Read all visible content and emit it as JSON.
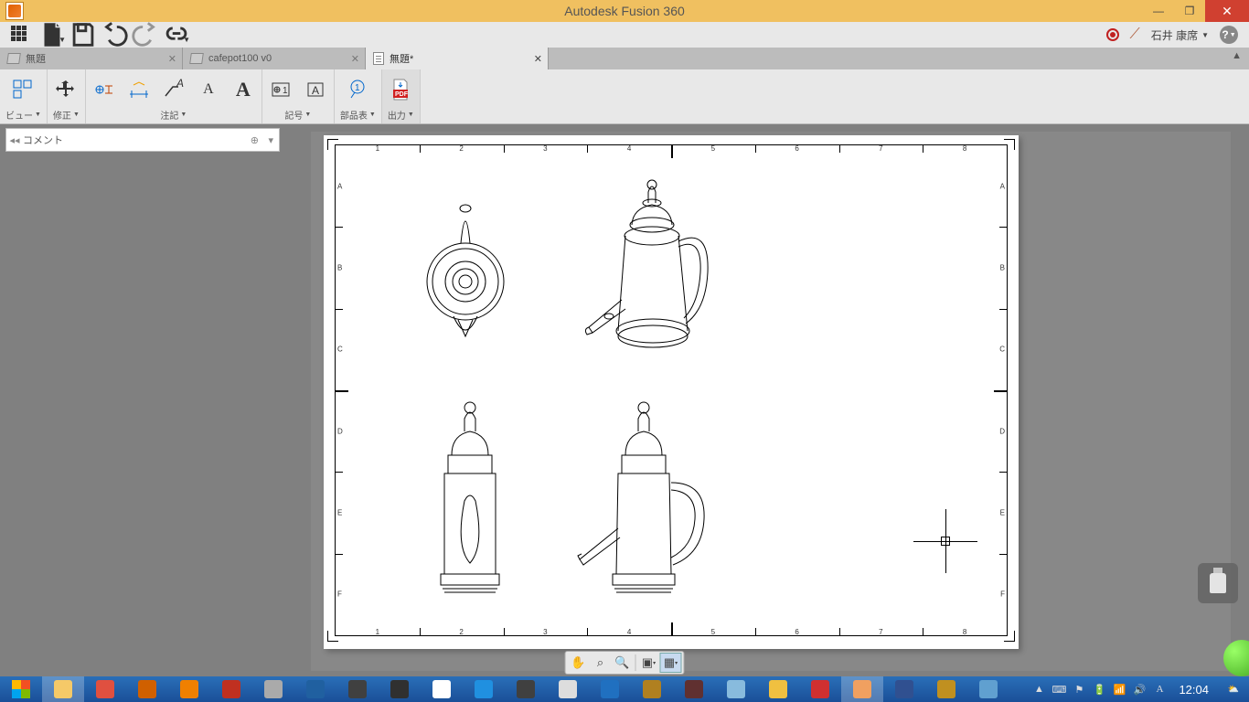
{
  "app": {
    "title": "Autodesk Fusion 360"
  },
  "user": {
    "name": "石井 康席"
  },
  "quick": {
    "icons": [
      "apps",
      "file",
      "save",
      "undo",
      "redo",
      "link"
    ]
  },
  "tabs": [
    {
      "label": "無題",
      "kind": "model",
      "active": false
    },
    {
      "label": "cafepot100 v0",
      "kind": "model",
      "active": false
    },
    {
      "label": "無題*",
      "kind": "sheet",
      "active": true
    }
  ],
  "ribbon": {
    "groups": [
      {
        "name": "view",
        "label": "ビュー",
        "icons": [
          "projview"
        ]
      },
      {
        "name": "modify",
        "label": "修正",
        "icons": [
          "move"
        ]
      },
      {
        "name": "annotate",
        "label": "注記",
        "icons": [
          "dim-target",
          "dim-line",
          "leader",
          "text-a",
          "text-A"
        ]
      },
      {
        "name": "symbol",
        "label": "記号",
        "icons": [
          "datum",
          "gdnt"
        ]
      },
      {
        "name": "parts",
        "label": "部品表",
        "icons": [
          "balloon"
        ]
      },
      {
        "name": "output",
        "label": "出力",
        "icons": [
          "pdf"
        ]
      }
    ]
  },
  "comments": {
    "label": "コメント"
  },
  "sheet": {
    "col_ticks": [
      "1",
      "2",
      "3",
      "4",
      "5",
      "6",
      "7",
      "8"
    ],
    "row_ticks": [
      "A",
      "B",
      "C",
      "D",
      "E",
      "F"
    ]
  },
  "viewbar": {
    "tools": [
      "pan",
      "zoom-window",
      "zoom",
      "fit",
      "display"
    ]
  },
  "taskbar": {
    "items": [
      {
        "name": "start",
        "bg": "#ffffff"
      },
      {
        "name": "explorer",
        "bg": "#f5c968",
        "active": true
      },
      {
        "name": "camera",
        "bg": "#e05040"
      },
      {
        "name": "office",
        "bg": "#d06000"
      },
      {
        "name": "media",
        "bg": "#f08000"
      },
      {
        "name": "sketchup",
        "bg": "#c03020"
      },
      {
        "name": "generic1",
        "bg": "#aaaaaa"
      },
      {
        "name": "earth",
        "bg": "#2060a0"
      },
      {
        "name": "app1",
        "bg": "#404040"
      },
      {
        "name": "eye",
        "bg": "#303030"
      },
      {
        "name": "chrome",
        "bg": "#ffffff"
      },
      {
        "name": "bluearrow",
        "bg": "#2090e0"
      },
      {
        "name": "swirl",
        "bg": "#404040"
      },
      {
        "name": "grid",
        "bg": "#dddddd"
      },
      {
        "name": "checkbox",
        "bg": "#2070c0"
      },
      {
        "name": "folder2",
        "bg": "#b08020"
      },
      {
        "name": "sphere",
        "bg": "#603030"
      },
      {
        "name": "app2",
        "bg": "#88bbdd"
      },
      {
        "name": "yellow",
        "bg": "#f0c040"
      },
      {
        "name": "opera",
        "bg": "#d03030"
      },
      {
        "name": "fusion",
        "bg": "#f0a060",
        "active": true
      },
      {
        "name": "word",
        "bg": "#305090"
      },
      {
        "name": "app3",
        "bg": "#c09020"
      },
      {
        "name": "photos",
        "bg": "#60a0d0"
      }
    ],
    "clock": "12:04"
  }
}
